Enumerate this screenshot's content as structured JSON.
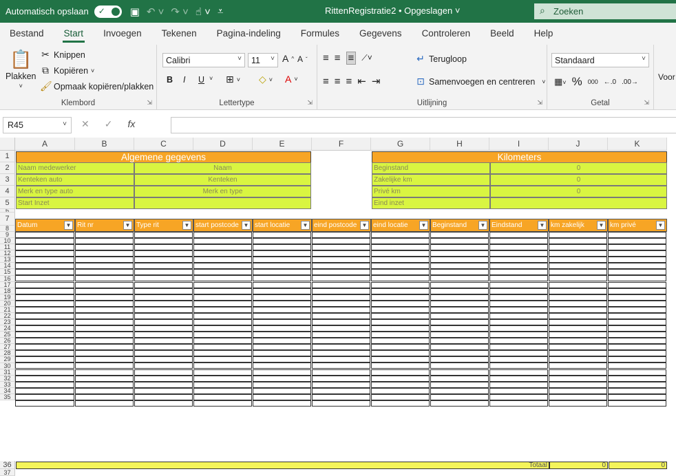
{
  "titlebar": {
    "autosave_label": "Automatisch opslaan",
    "doc_title": "RittenRegistratie2 • Opgeslagen",
    "search_placeholder": "Zoeken"
  },
  "tabs": [
    "Bestand",
    "Start",
    "Invoegen",
    "Tekenen",
    "Pagina-indeling",
    "Formules",
    "Gegevens",
    "Controleren",
    "Beeld",
    "Help"
  ],
  "active_tab": "Start",
  "ribbon": {
    "clipboard": {
      "paste": "Plakken",
      "cut": "Knippen",
      "copy": "Kopiëren",
      "format_painter": "Opmaak kopiëren/plakken",
      "label": "Klembord"
    },
    "font": {
      "name": "Calibri",
      "size": "11",
      "bold": "B",
      "italic": "I",
      "underline": "U",
      "label": "Lettertype"
    },
    "alignment": {
      "wrap": "Terugloop",
      "merge": "Samenvoegen en centreren",
      "label": "Uitlijning"
    },
    "number": {
      "format": "Standaard",
      "percent": "%",
      "thousands": "000",
      "label": "Getal"
    },
    "styles_partial": "Voor"
  },
  "formula_bar": {
    "name_box": "R45",
    "fx": "fx",
    "value": ""
  },
  "columns": [
    "A",
    "B",
    "C",
    "D",
    "E",
    "F",
    "G",
    "H",
    "I",
    "J",
    "K"
  ],
  "sheet": {
    "general_title": "Algemene gegevens",
    "general_rows": [
      {
        "label": "Naam medewerker",
        "value": "Naam"
      },
      {
        "label": "Kenteken auto",
        "value": "Kenteken"
      },
      {
        "label": "Merk en type auto",
        "value": "Merk en type"
      },
      {
        "label": "Start Inzet",
        "value": ""
      }
    ],
    "km_title": "Kilometers",
    "km_rows": [
      {
        "label": "Beginstand",
        "value": "0"
      },
      {
        "label": "Zakelijke km",
        "value": "0"
      },
      {
        "label": "Privé km",
        "value": "0"
      },
      {
        "label": "Eind inzet",
        "value": ""
      }
    ],
    "table_headers": [
      "Datum",
      "Rit nr",
      "Type rit",
      "start postcode",
      "start locatie",
      "eind postcode",
      "eind locatie",
      "Beginstand",
      "Eindstand",
      "km zakelijk",
      "km privé"
    ],
    "total_label": "Totaal",
    "total_zakelijk": "0",
    "total_prive": "0"
  },
  "row_numbers": [
    "1",
    "2",
    "3",
    "4",
    "5",
    "6",
    "7",
    "8",
    "9",
    "10",
    "11",
    "12",
    "13",
    "14",
    "15",
    "16",
    "17",
    "18",
    "19",
    "20",
    "21",
    "22",
    "23",
    "24",
    "25",
    "26",
    "27",
    "28",
    "29",
    "30",
    "31",
    "32",
    "33",
    "34",
    "35",
    "36",
    "37"
  ]
}
